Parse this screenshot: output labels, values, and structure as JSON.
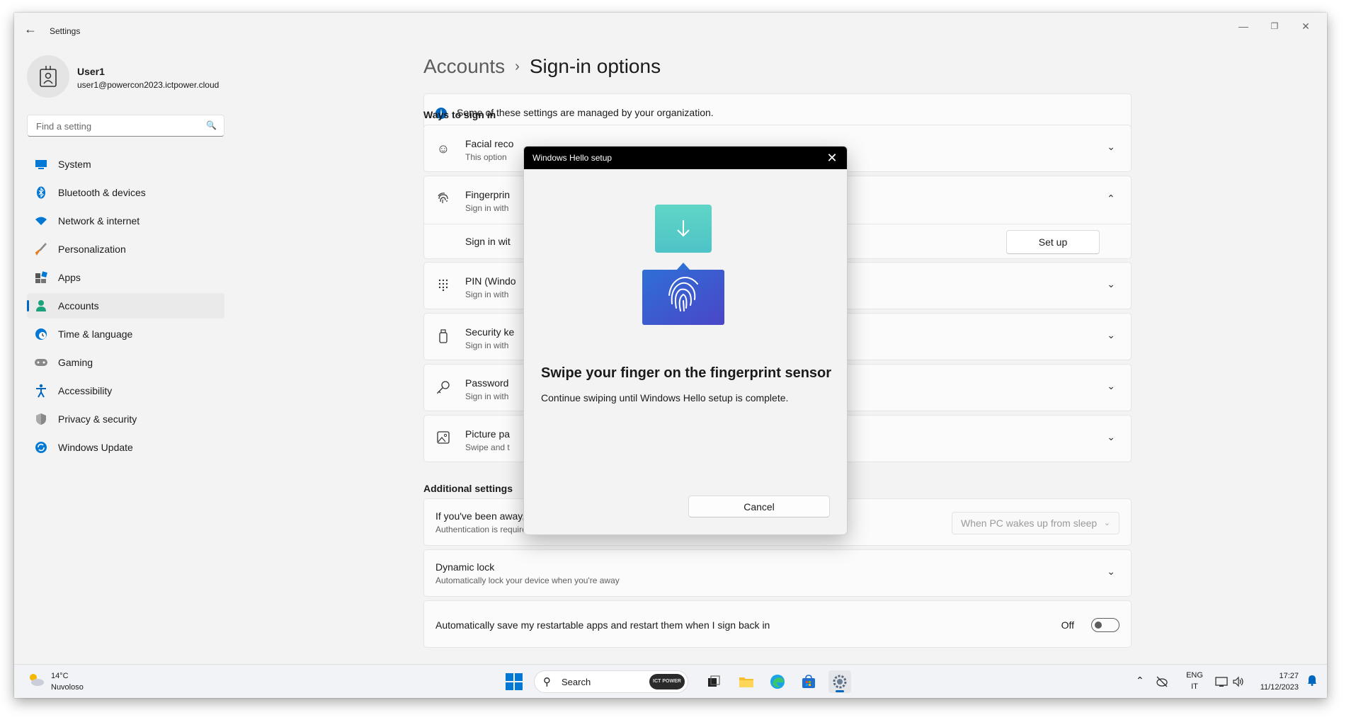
{
  "window": {
    "app_title": "Settings",
    "back_icon": "back-arrow-icon",
    "minimize": "—",
    "restore": "❐",
    "close": "✕"
  },
  "user": {
    "name": "User1",
    "email": "user1@powercon2023.ictpower.cloud"
  },
  "search": {
    "placeholder": "Find a setting"
  },
  "sidebar": {
    "items": [
      {
        "label": "System",
        "icon": "monitor-icon",
        "color": "#0078d4"
      },
      {
        "label": "Bluetooth & devices",
        "icon": "bluetooth-icon",
        "color": "#0078d4"
      },
      {
        "label": "Network & internet",
        "icon": "wifi-icon",
        "color": "#0078d4"
      },
      {
        "label": "Personalization",
        "icon": "brush-icon",
        "color": "#e67e22"
      },
      {
        "label": "Apps",
        "icon": "apps-icon",
        "color": "#555555"
      },
      {
        "label": "Accounts",
        "icon": "person-icon",
        "color": "#1aa37a"
      },
      {
        "label": "Time & language",
        "icon": "globe-clock-icon",
        "color": "#0078d4"
      },
      {
        "label": "Gaming",
        "icon": "gamepad-icon",
        "color": "#777777"
      },
      {
        "label": "Accessibility",
        "icon": "accessibility-icon",
        "color": "#0067c0"
      },
      {
        "label": "Privacy & security",
        "icon": "shield-icon",
        "color": "#666666"
      },
      {
        "label": "Windows Update",
        "icon": "update-icon",
        "color": "#0078d4"
      }
    ],
    "selected": "Accounts"
  },
  "breadcrumb": {
    "parent": "Accounts",
    "separator": "›",
    "current": "Sign-in options"
  },
  "banner": {
    "text": "Some of these settings are managed by your organization."
  },
  "ways": {
    "heading": "Ways to sign in",
    "rows": [
      {
        "title": "Facial reco",
        "subtitle": "This option"
      },
      {
        "title": "Fingerprin",
        "subtitle": "Sign in with"
      },
      {
        "title": "PIN (Windo",
        "subtitle": "Sign in with"
      },
      {
        "title": "Security ke",
        "subtitle": "Sign in with"
      },
      {
        "title": "Password",
        "subtitle": "Sign in with"
      },
      {
        "title": "Picture pa",
        "subtitle": "Swipe and t"
      }
    ],
    "fingerprint_sub": "Sign in wit",
    "setup_label": "Set up"
  },
  "additional": {
    "heading": "Additional settings",
    "require": {
      "title": "If you've been away, when should Windows require you to sign in again?",
      "subtitle": "Authentication is required when this PC wakes from sleep. Sign in as an administrator to change this setting.",
      "value": "When PC wakes up from sleep"
    },
    "dynamic": {
      "title": "Dynamic lock",
      "subtitle": "Automatically lock your device when you're away"
    },
    "restart": {
      "title": "Automatically save my restartable apps and restart them when I sign back in",
      "state": "Off"
    }
  },
  "dialog": {
    "title": "Windows Hello setup",
    "heading": "Swipe your finger on the fingerprint sensor",
    "body": "Continue swiping until Windows Hello setup is complete.",
    "cancel": "Cancel"
  },
  "taskbar": {
    "temp": "14°C",
    "condition": "Nuvoloso",
    "search": "Search",
    "search_badge": "ICT POWER",
    "lang1": "ENG",
    "lang2": "IT",
    "time": "17:27",
    "date": "11/12/2023"
  }
}
